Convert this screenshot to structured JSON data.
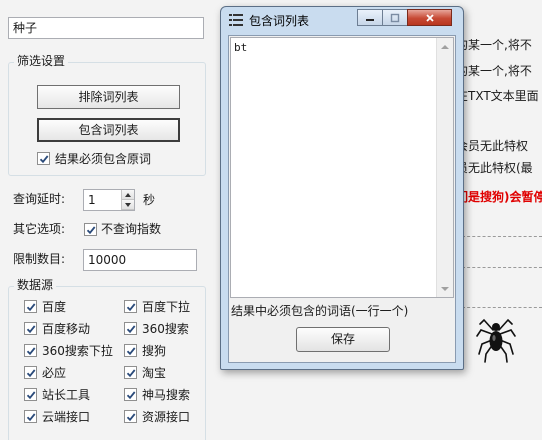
{
  "seed_field": {
    "value": "种子"
  },
  "filter_group": {
    "legend": "筛选设置",
    "exclude_button": "排除词列表",
    "include_button": "包含词列表",
    "must_contain_checkbox": {
      "label": "结果必须包含原词",
      "checked": true
    }
  },
  "query_delay": {
    "label": "查询延时:",
    "value": "1",
    "unit": "秒"
  },
  "other_options": {
    "label": "其它选项:",
    "no_index_checkbox": {
      "label": "不查询指数",
      "checked": true
    }
  },
  "limit": {
    "label": "限制数目:",
    "value": "10000"
  },
  "data_source": {
    "legend": "数据源",
    "items": [
      {
        "label": "百度",
        "checked": true
      },
      {
        "label": "百度下拉",
        "checked": true
      },
      {
        "label": "百度移动",
        "checked": true
      },
      {
        "label": "360搜索",
        "checked": true
      },
      {
        "label": "360搜索下拉",
        "checked": true
      },
      {
        "label": "搜狗",
        "checked": true
      },
      {
        "label": "必应",
        "checked": true
      },
      {
        "label": "淘宝",
        "checked": true
      },
      {
        "label": "站长工具",
        "checked": true
      },
      {
        "label": "神马搜索",
        "checked": true
      },
      {
        "label": "云端接口",
        "checked": true
      },
      {
        "label": "资源接口",
        "checked": true
      }
    ]
  },
  "background_right": {
    "line1": "的某一个,将不",
    "line2": "的某一个,将不",
    "line3": "在TXT文本里面",
    "line4": "会员无此特权",
    "line5": "员无此特权(最",
    "line6": "们是搜狗)会暂停",
    "line6_color": "#e00000",
    "mascot_icon": "spider-icon"
  },
  "popup": {
    "title": "包含词列表",
    "title_icon": "list-icon",
    "editor_text": "bt",
    "hint": "结果中必须包含的词语(一行一个)",
    "save_button": "保存"
  }
}
